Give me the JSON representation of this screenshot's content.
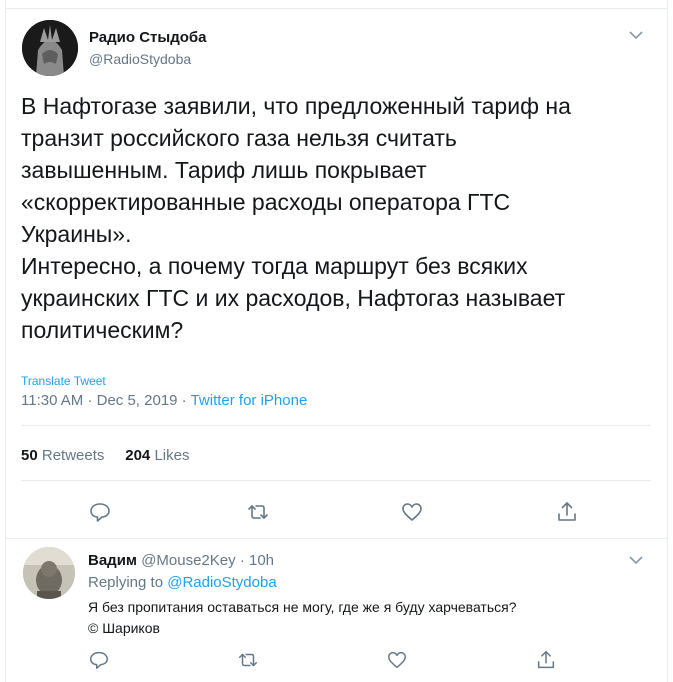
{
  "main_tweet": {
    "author_name": "Радио Стыдоба",
    "author_handle": "@RadioStydoba",
    "text": "В Нафтогазе заявили, что предложенный тариф на\nтранзит российского газа нельзя считать\nзавышенным. Тариф лишь покрывает\n«скорректированные расходы оператора ГТС\nУкраины».\nИнтересно, а почему тогда маршрут без всяких\nукраинских ГТС и их расходов, Нафтогаз называет\nполитическим?",
    "translate_label": "Translate Tweet",
    "time": "11:30 AM",
    "date": "Dec 5, 2019",
    "source": "Twitter for iPhone",
    "retweets_count": "50",
    "retweets_label": "Retweets",
    "likes_count": "204",
    "likes_label": "Likes"
  },
  "reply": {
    "author_name": "Вадим",
    "author_handle": "@Mouse2Key",
    "age": "10h",
    "replying_to_label": "Replying to",
    "replying_to_handle": "@RadioStydoba",
    "text": "Я без пропитания оставаться не могу, где же я буду харчеваться?\n© Шариков"
  },
  "icons": {
    "reply": "reply-icon",
    "retweet": "retweet-icon",
    "like": "heart-icon",
    "share": "share-icon",
    "menu": "chevron-down-icon"
  },
  "colors": {
    "accent": "#1da1f2",
    "secondary": "#657786",
    "text": "#14171a",
    "divider": "#e6ecf0"
  }
}
